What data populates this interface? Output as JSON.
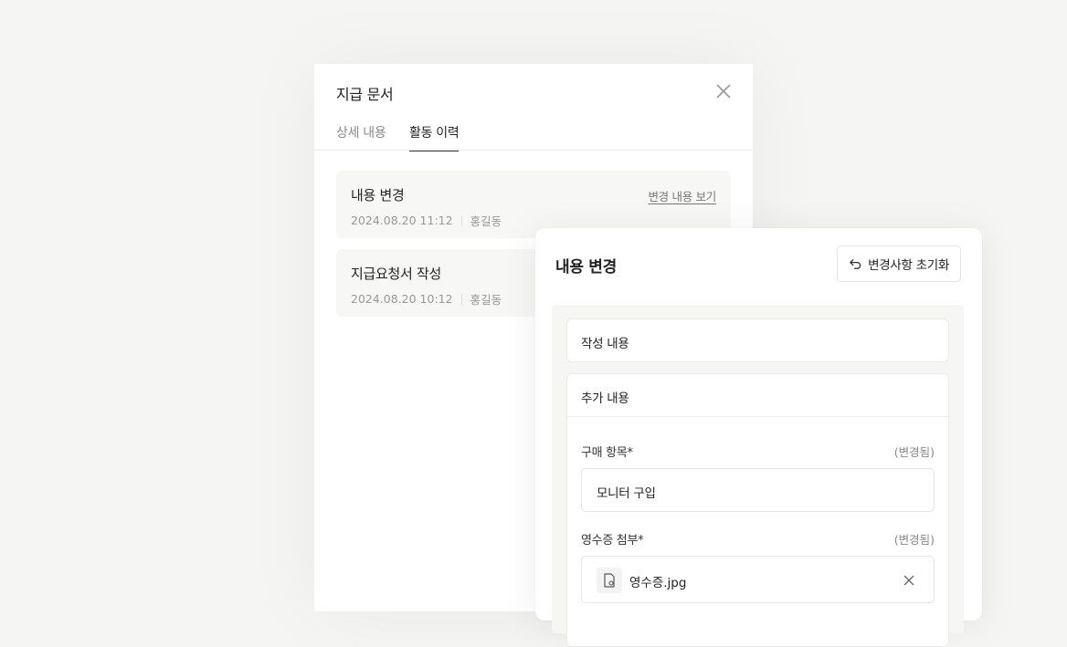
{
  "doc_panel": {
    "title": "지급 문서",
    "tabs": [
      {
        "label": "상세 내용",
        "active": false
      },
      {
        "label": "활동 이력",
        "active": true
      }
    ],
    "activities": [
      {
        "title": "내용 변경",
        "datetime": "2024.08.20 11:12",
        "author": "홍길동",
        "link": "변경 내용 보기"
      },
      {
        "title": "지급요청서 작성",
        "datetime": "2024.08.20 10:12",
        "author": "홍길동"
      }
    ]
  },
  "change_card": {
    "title": "내용 변경",
    "reset_label": "변경사항 초기화",
    "sections": {
      "written": {
        "label": "작성 내용"
      },
      "added": {
        "label": "추가 내용",
        "fields": {
          "purchase_item": {
            "label": "구매 항목*",
            "status": "(변경됨)",
            "value": "모니터 구입"
          },
          "receipt": {
            "label": "영수증 첨부*",
            "status": "(변경됨)",
            "file_name": "영수증.jpg"
          }
        }
      }
    }
  },
  "icons": {
    "close": "close-icon",
    "reset": "undo-arrow-icon",
    "file": "file-image-icon",
    "remove": "remove-x-icon"
  }
}
